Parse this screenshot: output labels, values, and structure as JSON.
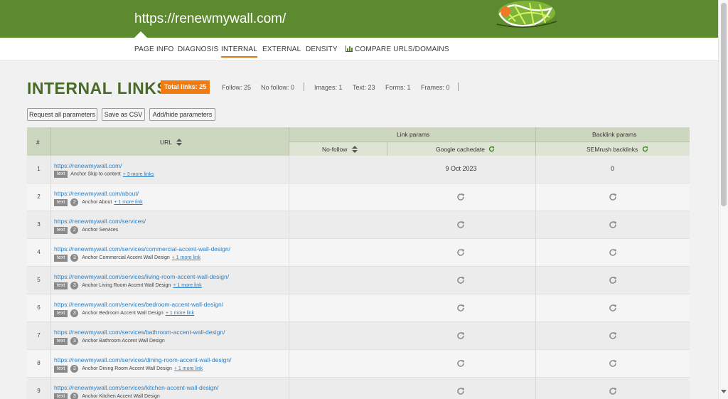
{
  "header": {
    "url": "https://renewmywall.com/"
  },
  "nav": {
    "tabs": [
      {
        "label": "PAGE INFO"
      },
      {
        "label": "DIAGNOSIS"
      },
      {
        "label": "INTERNAL"
      },
      {
        "label": "EXTERNAL"
      },
      {
        "label": "DENSITY"
      },
      {
        "label": "COMPARE URLS/DOMAINS"
      }
    ],
    "active_tab": "INTERNAL",
    "accent": "#e07a10"
  },
  "title": "INTERNAL LINKS",
  "stats": {
    "total": "Total links:  25",
    "follow": "Follow:  25",
    "nofollow": "No follow:  0",
    "images": "Images:  1",
    "text": "Text:  23",
    "forms": "Forms:  1",
    "frames": "Frames:  0"
  },
  "buttons": {
    "request_all": "Request all parameters",
    "save_csv": "Save as CSV",
    "add_hide": "Add/hide parameters"
  },
  "table": {
    "col_num": "#",
    "col_url": "URL",
    "group_link": "Link params",
    "group_backlink": "Backlink params",
    "col_nofollow": "No-follow",
    "col_cache": "Google cachedate",
    "col_semrush": "SEMrush backlinks",
    "rows": [
      {
        "num": "1",
        "url": "https://renewmywall.com/",
        "type": "text",
        "count": "",
        "anchor": "Anchor Skip to content",
        "more": "+ 3 more links",
        "cache": "9 Oct 2023",
        "semrush": "0"
      },
      {
        "num": "2",
        "url": "https://renewmywall.com/about/",
        "type": "text",
        "count": "2",
        "anchor": "Anchor About",
        "more": "+ 1 more link",
        "cache": "",
        "semrush": ""
      },
      {
        "num": "3",
        "url": "https://renewmywall.com/services/",
        "type": "text",
        "count": "2",
        "anchor": "Anchor Services",
        "more": "",
        "cache": "",
        "semrush": ""
      },
      {
        "num": "4",
        "url": "https://renewmywall.com/services/commercial-accent-wall-design/",
        "type": "text",
        "count": "3",
        "anchor": "Anchor Commercial Accent Wall Design",
        "more": "+ 1 more link",
        "cache": "",
        "semrush": ""
      },
      {
        "num": "5",
        "url": "https://renewmywall.com/services/living-room-accent-wall-design/",
        "type": "text",
        "count": "3",
        "anchor": "Anchor Living Room Accent Wall Design",
        "more": "+ 1 more link",
        "cache": "",
        "semrush": ""
      },
      {
        "num": "6",
        "url": "https://renewmywall.com/services/bedroom-accent-wall-design/",
        "type": "text",
        "count": "3",
        "anchor": "Anchor Bedroom Accent Wall Design",
        "more": "+ 1 more link",
        "cache": "",
        "semrush": ""
      },
      {
        "num": "7",
        "url": "https://renewmywall.com/services/bathroom-accent-wall-design/",
        "type": "text",
        "count": "3",
        "anchor": "Anchor Bathroom Accent Wall Design",
        "more": "",
        "cache": "",
        "semrush": ""
      },
      {
        "num": "8",
        "url": "https://renewmywall.com/services/dining-room-accent-wall-design/",
        "type": "text",
        "count": "3",
        "anchor": "Anchor Dining Room Accent Wall Design",
        "more": "+ 1 more link",
        "cache": "",
        "semrush": ""
      },
      {
        "num": "9",
        "url": "https://renewmywall.com/services/kitchen-accent-wall-design/",
        "type": "text",
        "count": "3",
        "anchor": "Anchor Kitchen Accent Wall Design",
        "more": "",
        "cache": "",
        "semrush": ""
      }
    ]
  },
  "colors": {
    "header_green": "#5e8a2f",
    "title_green": "#4a6a2a",
    "total_orange": "#f27b12",
    "link_blue": "#2a7fc5"
  },
  "icons": {
    "sort": "sort-arrows-icon",
    "refresh": "refresh-icon",
    "chart": "bar-chart-icon",
    "logo": "site-logo-icon"
  }
}
